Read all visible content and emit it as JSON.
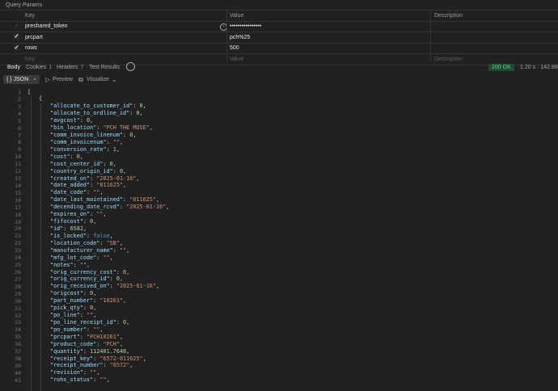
{
  "query_params": {
    "title": "Query Params",
    "headers": {
      "key": "Key",
      "value": "Value",
      "description": "Description"
    },
    "rows": [
      {
        "key": "preshared_token",
        "value": "••••••••••••••••",
        "enabled": false
      },
      {
        "key": "prcpart",
        "value": "pch%25",
        "enabled": true
      },
      {
        "key": "rows",
        "value": "500",
        "enabled": true
      }
    ],
    "placeholder": {
      "key": "Key",
      "value": "Value",
      "description": "Description"
    }
  },
  "response_tabs": [
    {
      "label": "Body",
      "count": ""
    },
    {
      "label": "Cookies",
      "count": "1"
    },
    {
      "label": "Headers",
      "count": "7"
    },
    {
      "label": "Test Results",
      "count": ""
    }
  ],
  "status": {
    "code": "200 OK",
    "time": "1.20 s",
    "size": "142.88"
  },
  "toolbar": {
    "format": "JSON",
    "preview": "Preview",
    "visualize": "Visualize"
  },
  "json_lines": [
    {
      "n": "1",
      "ind": 0,
      "raw": "["
    },
    {
      "n": "2",
      "ind": 1,
      "raw": "{"
    },
    {
      "n": "3",
      "ind": 2,
      "k": "allocate_to_customer_id",
      "v": "0",
      "t": "n"
    },
    {
      "n": "4",
      "ind": 2,
      "k": "allocate_to_ordline_id",
      "v": "0",
      "t": "n"
    },
    {
      "n": "5",
      "ind": 2,
      "k": "avgcost",
      "v": "0",
      "t": "n"
    },
    {
      "n": "6",
      "ind": 2,
      "k": "bin_location",
      "v": "\"PCH THE MUSE\"",
      "t": "s"
    },
    {
      "n": "7",
      "ind": 2,
      "k": "comm_invoice_linenum",
      "v": "0",
      "t": "n"
    },
    {
      "n": "8",
      "ind": 2,
      "k": "comm_invoicenum",
      "v": "\"\"",
      "t": "s"
    },
    {
      "n": "9",
      "ind": 2,
      "k": "conversion_rate",
      "v": "1",
      "t": "n"
    },
    {
      "n": "10",
      "ind": 2,
      "k": "cost",
      "v": "0",
      "t": "n"
    },
    {
      "n": "11",
      "ind": 2,
      "k": "cost_center_id",
      "v": "0",
      "t": "n"
    },
    {
      "n": "12",
      "ind": 2,
      "k": "country_origin_id",
      "v": "0",
      "t": "n"
    },
    {
      "n": "13",
      "ind": 2,
      "k": "created_on",
      "v": "\"2025-01-16\"",
      "t": "s"
    },
    {
      "n": "14",
      "ind": 2,
      "k": "date_added",
      "v": "\"011625\"",
      "t": "s"
    },
    {
      "n": "15",
      "ind": 2,
      "k": "date_code",
      "v": "\"\"",
      "t": "s"
    },
    {
      "n": "16",
      "ind": 2,
      "k": "date_last_maintained",
      "v": "\"011625\"",
      "t": "s"
    },
    {
      "n": "17",
      "ind": 2,
      "k": "decending_date_rcvd",
      "v": "\"2025-01-16\"",
      "t": "s"
    },
    {
      "n": "18",
      "ind": 2,
      "k": "expires_on",
      "v": "\"\"",
      "t": "s"
    },
    {
      "n": "19",
      "ind": 2,
      "k": "fifocost",
      "v": "0",
      "t": "n"
    },
    {
      "n": "20",
      "ind": 2,
      "k": "id",
      "v": "6582",
      "t": "n"
    },
    {
      "n": "21",
      "ind": 2,
      "k": "is_locked",
      "v": "false",
      "t": "b"
    },
    {
      "n": "22",
      "ind": 2,
      "k": "location_code",
      "v": "\"SB\"",
      "t": "s"
    },
    {
      "n": "23",
      "ind": 2,
      "k": "manufacturer_name",
      "v": "\"\"",
      "t": "s"
    },
    {
      "n": "24",
      "ind": 2,
      "k": "mfg_lot_code",
      "v": "\"\"",
      "t": "s"
    },
    {
      "n": "25",
      "ind": 2,
      "k": "notes",
      "v": "\"\"",
      "t": "s"
    },
    {
      "n": "26",
      "ind": 2,
      "k": "orig_currency_cost",
      "v": "0",
      "t": "n"
    },
    {
      "n": "27",
      "ind": 2,
      "k": "orig_currency_id",
      "v": "0",
      "t": "n"
    },
    {
      "n": "28",
      "ind": 2,
      "k": "orig_received_on",
      "v": "\"2025-01-16\"",
      "t": "s"
    },
    {
      "n": "29",
      "ind": 2,
      "k": "origcost",
      "v": "0",
      "t": "n"
    },
    {
      "n": "30",
      "ind": 2,
      "k": "part_number",
      "v": "\"10261\"",
      "t": "s"
    },
    {
      "n": "31",
      "ind": 2,
      "k": "pick_qty",
      "v": "0",
      "t": "n"
    },
    {
      "n": "32",
      "ind": 2,
      "k": "po_line",
      "v": "\"\"",
      "t": "s"
    },
    {
      "n": "33",
      "ind": 2,
      "k": "po_line_receipt_id",
      "v": "0",
      "t": "n"
    },
    {
      "n": "34",
      "ind": 2,
      "k": "po_number",
      "v": "\"\"",
      "t": "s"
    },
    {
      "n": "35",
      "ind": 2,
      "k": "prcpart",
      "v": "\"PCH10261\"",
      "t": "s"
    },
    {
      "n": "36",
      "ind": 2,
      "k": "product_code",
      "v": "\"PCH\"",
      "t": "s"
    },
    {
      "n": "37",
      "ind": 2,
      "k": "quantity",
      "v": "112401.7648",
      "t": "n"
    },
    {
      "n": "38",
      "ind": 2,
      "k": "receipt_key",
      "v": "\"6572-011625\"",
      "t": "s"
    },
    {
      "n": "39",
      "ind": 2,
      "k": "receipt_number",
      "v": "\"6572\"",
      "t": "s"
    },
    {
      "n": "40",
      "ind": 2,
      "k": "revision",
      "v": "\"\"",
      "t": "s"
    },
    {
      "n": "41",
      "ind": 2,
      "k": "rohs_status",
      "v": "\"\"",
      "t": "s"
    }
  ]
}
